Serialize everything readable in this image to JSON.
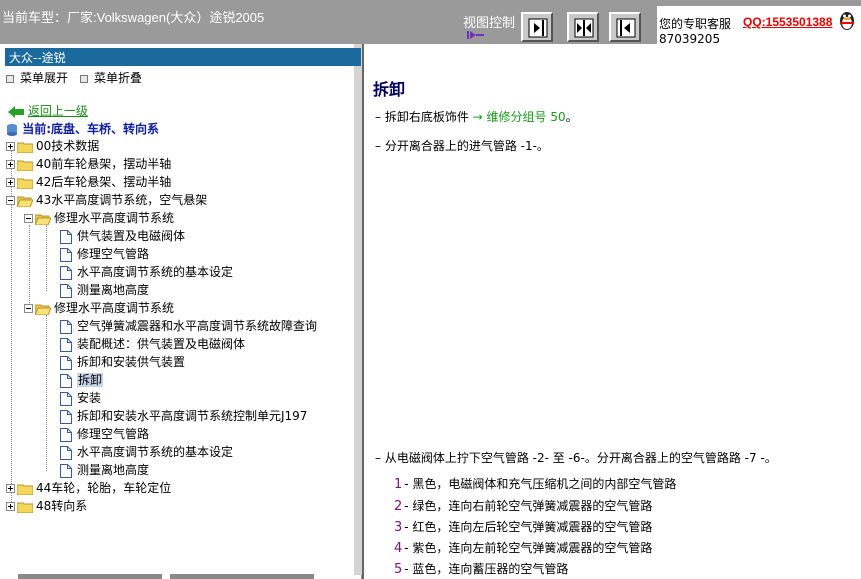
{
  "header": {
    "car_title": "当前车型：厂家:Volkswagen(大众）途锐2005",
    "view_control": "视图控制",
    "support_text": "您的专职客服",
    "support_qq": "QQ:1553501388",
    "support_phone": "87039205"
  },
  "sidebar": {
    "heading": "大众--途锐",
    "expand_label": "菜单展开",
    "collapse_label": "菜单折叠",
    "back_label": "返回上一级",
    "current_label": "当前:底盘、车桥、转向系",
    "tree": {
      "n00": "00技术数据",
      "n40": "40前车轮悬架，摆动半轴",
      "n42": "42后车轮悬架、摆动半轴",
      "n43": "43水平高度调节系统，空气悬架",
      "g1": "修理水平高度调节系统",
      "g1a": "供气装置及电磁阀体",
      "g1b": "修理空气管路",
      "g1c": "水平高度调节系统的基本设定",
      "g1d": "测量离地高度",
      "g2": "修理水平高度调节系统",
      "g2a": "空气弹簧减震器和水平高度调节系统故障查询",
      "g2b": "装配概述：供气装置及电磁阀体",
      "g2c": "拆卸和安装供气装置",
      "g2d": "拆卸",
      "g2e": "安装",
      "g2f": "拆卸和安装水平高度调节系统控制单元J197",
      "g2g": "修理空气管路",
      "g2h": "水平高度调节系统的基本设定",
      "g2i": "测量离地高度",
      "n44": "44车轮，轮胎，车轮定位",
      "n48": "48转向系"
    }
  },
  "content": {
    "title": "拆卸",
    "step1_prefix": "–  拆卸右底板饰件 ",
    "step1_link": "→ 维修分组号 50",
    "step1_suffix": "。",
    "step2": "–  分开离合器上的进气管路 -1-。",
    "step3": "–  从电磁阀体上拧下空气管路 -2- 至 -6-。分开离合器上的空气管路路 -7 -。",
    "items": [
      {
        "n": "1",
        "text": "- 黑色，电磁阀体和充气压缩机之间的内部空气管路"
      },
      {
        "n": "2",
        "text": "- 绿色，连向右前轮空气弹簧减震器的空气管路"
      },
      {
        "n": "3",
        "text": "- 红色，连向左后轮空气弹簧减震器的空气管路"
      },
      {
        "n": "4",
        "text": "- 紫色，连向左前轮空气弹簧减震器的空气管路"
      },
      {
        "n": "5",
        "text": "- 蓝色，连向蓄压器的空气管路"
      }
    ]
  },
  "colors": {
    "header_bg": "#9a9a9a",
    "sidebar_heading_bg": "#1b6a9e",
    "title": "#000060",
    "link_green": "#1a9a1a"
  }
}
